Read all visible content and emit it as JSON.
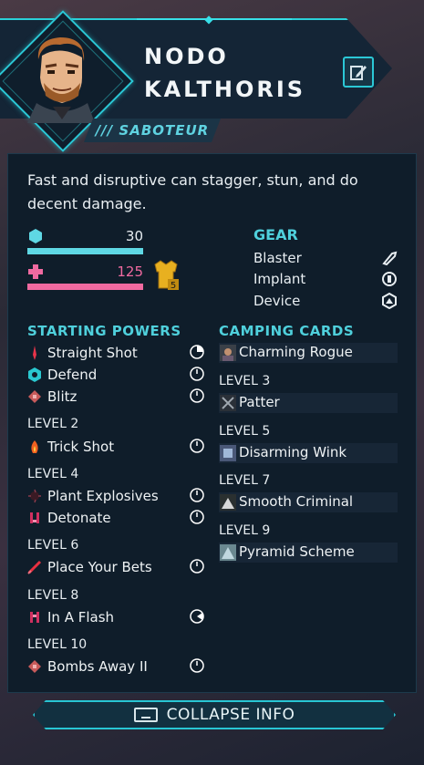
{
  "character": {
    "name_line1": "NODO",
    "name_line2": "KALTHORIS",
    "class_label": "/// SABOTEUR",
    "description": "Fast and disruptive can stagger, stun, and do decent damage."
  },
  "stats": {
    "shield": {
      "value": "30",
      "fill": 1.0
    },
    "health": {
      "value": "125",
      "fill": 1.0
    },
    "armor_badge": "5"
  },
  "gear": {
    "title": "GEAR",
    "items": [
      {
        "label": "Blaster",
        "icon": "blaster-icon"
      },
      {
        "label": "Implant",
        "icon": "implant-icon"
      },
      {
        "label": "Device",
        "icon": "device-icon"
      }
    ]
  },
  "powers": {
    "title": "STARTING POWERS",
    "starting": [
      {
        "label": "Straight Shot",
        "icon": "straight-shot-icon"
      },
      {
        "label": "Defend",
        "icon": "defend-icon"
      },
      {
        "label": "Blitz",
        "icon": "blitz-icon"
      }
    ],
    "levels": [
      {
        "level": "LEVEL 2",
        "items": [
          {
            "label": "Trick Shot",
            "icon": "trick-shot-icon"
          }
        ]
      },
      {
        "level": "LEVEL 4",
        "items": [
          {
            "label": "Plant Explosives",
            "icon": "plant-explosives-icon"
          },
          {
            "label": "Detonate",
            "icon": "detonate-icon"
          }
        ]
      },
      {
        "level": "LEVEL 6",
        "items": [
          {
            "label": "Place Your Bets",
            "icon": "place-your-bets-icon"
          }
        ]
      },
      {
        "level": "LEVEL 8",
        "items": [
          {
            "label": "In A Flash",
            "icon": "in-a-flash-icon"
          }
        ]
      },
      {
        "level": "LEVEL 10",
        "items": [
          {
            "label": "Bombs Away II",
            "icon": "bombs-away-icon"
          }
        ]
      }
    ]
  },
  "camping": {
    "title": "CAMPING CARDS",
    "start": {
      "label": "Charming Rogue"
    },
    "levels": [
      {
        "level": "LEVEL 3",
        "label": "Patter"
      },
      {
        "level": "LEVEL 5",
        "label": "Disarming Wink"
      },
      {
        "level": "LEVEL 7",
        "label": "Smooth Criminal"
      },
      {
        "level": "LEVEL 9",
        "label": "Pyramid Scheme"
      }
    ]
  },
  "footer": {
    "collapse_label": "COLLAPSE INFO"
  },
  "colors": {
    "accent": "#4fd0dc",
    "shield": "#5fd8e4",
    "health": "#f06aa0",
    "armor": "#e8b020"
  }
}
